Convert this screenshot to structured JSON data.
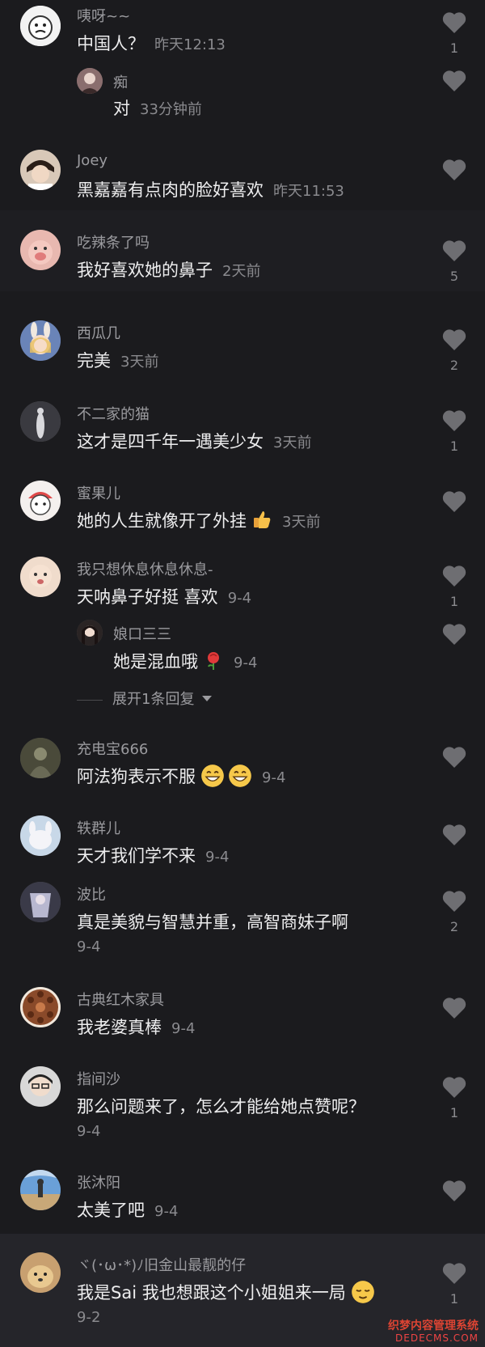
{
  "comments": [
    {
      "name": "咦呀~~",
      "text": "中国人？",
      "time": "昨天12:13",
      "likes": "1",
      "reply": {
        "name": "痴",
        "text": "对",
        "time": "33分钟前"
      }
    },
    {
      "name": "Joey",
      "text": "黑嘉嘉有点肉的脸好喜欢",
      "time": "昨天11:53",
      "likes": ""
    },
    {
      "name": "吃辣条了吗",
      "text": "我好喜欢她的鼻子",
      "time": "2天前",
      "likes": "5"
    },
    {
      "name": "西瓜几",
      "text": "完美",
      "time": "3天前",
      "likes": "2"
    },
    {
      "name": "不二家的猫",
      "text": "这才是四千年一遇美少女",
      "time": "3天前",
      "likes": "1"
    },
    {
      "name": "蜜果儿",
      "text": "她的人生就像开了外挂",
      "time": "3天前",
      "likes": ""
    },
    {
      "name": "我只想休息休息休息-",
      "text": "天呐鼻子好挺 喜欢",
      "time": "9-4",
      "likes": "1",
      "reply": {
        "name": "娘口三三",
        "text": "她是混血哦",
        "time": "9-4"
      },
      "expand": "展开1条回复"
    },
    {
      "name": "充电宝666",
      "text": "阿法狗表示不服",
      "time": "9-4",
      "likes": ""
    },
    {
      "name": "轶群儿",
      "text": "天才我们学不来",
      "time": "9-4",
      "likes": ""
    },
    {
      "name": "波比",
      "text": "真是美貌与智慧并重，高智商妹子啊",
      "time": "9-4",
      "likes": "2"
    },
    {
      "name": "古典红木家具",
      "text": "我老婆真棒",
      "time": "9-4",
      "likes": ""
    },
    {
      "name": "指间沙",
      "text": "那么问题来了，怎么才能给她点赞呢？",
      "time": "9-4",
      "likes": "1"
    },
    {
      "name": "张沐阳",
      "text": "太美了吧",
      "time": "9-4",
      "likes": ""
    },
    {
      "name": "ヾ(･ω･*)ﾉ旧金山最靓的仔",
      "text": "我是Sai 我也想跟这个小姐姐来一局",
      "time": "9-2",
      "likes": "1"
    }
  ],
  "watermark": {
    "line1": "织梦内容管理系统",
    "line2": "DEDECMS.COM"
  },
  "colors": {
    "background": "#1b1b1e",
    "text": "#ededee",
    "meta": "#8a8a8e",
    "heart": "#6e6e72"
  }
}
